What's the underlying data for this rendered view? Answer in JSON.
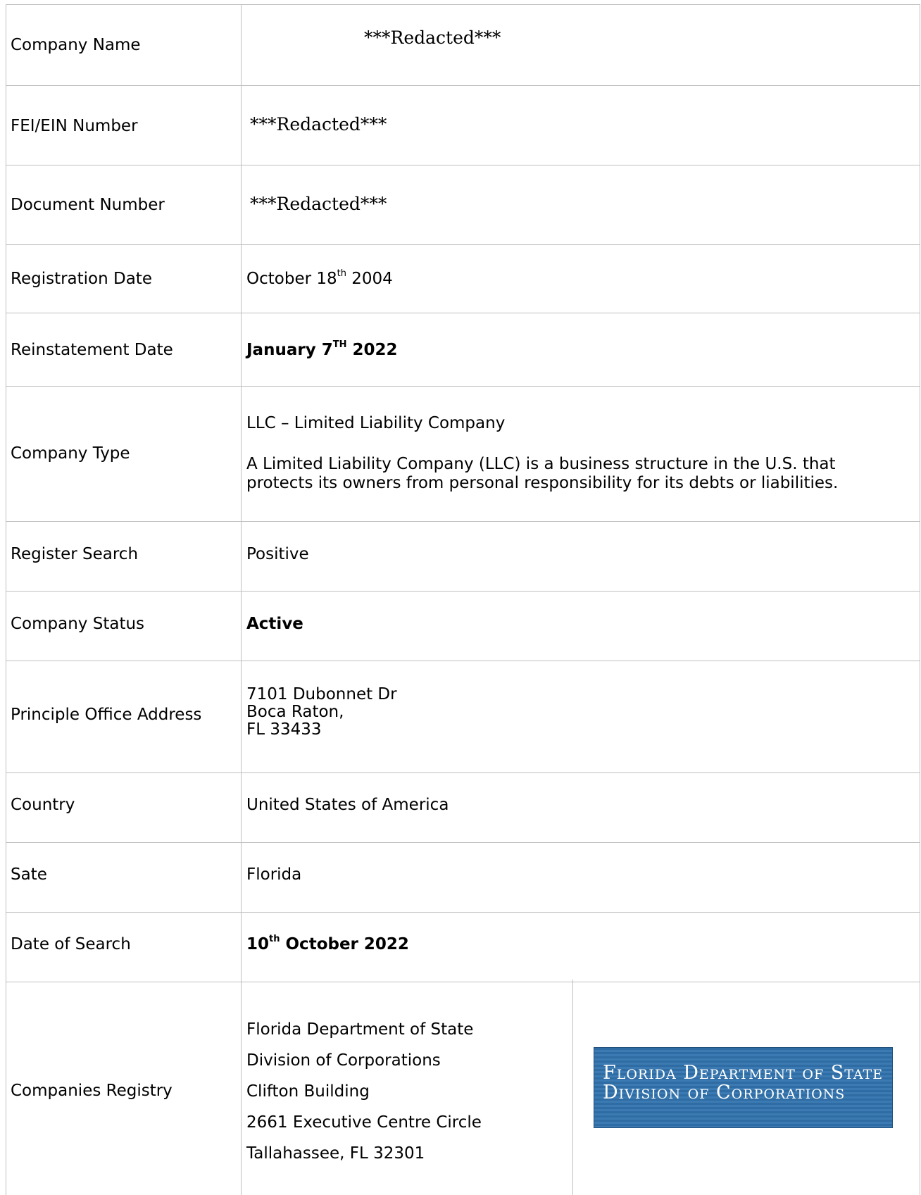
{
  "rows": [
    {
      "label": "Company Name",
      "value": "***Redacted***"
    },
    {
      "label": "FEI/EIN Number",
      "value": "***Redacted***"
    },
    {
      "label": "Document Number",
      "value": "***Redacted***"
    },
    {
      "label": "Registration Date",
      "value_main": "October 18",
      "value_sup": "th",
      "value_tail": " 2004"
    },
    {
      "label": "Reinstatement Date",
      "value_main": "January 7",
      "value_sup": "TH",
      "value_tail": " 2022"
    },
    {
      "label": "Company Type",
      "value_line1": "LLC – Limited Liability Company",
      "value_para": "A Limited Liability Company (LLC) is a business structure in the U.S. that protects its owners from personal responsibility for its debts or liabilities."
    },
    {
      "label": "Register Search",
      "value": "Positive"
    },
    {
      "label": "Company Status",
      "value": "Active"
    },
    {
      "label": "Principle Office Address",
      "lines": [
        "7101 Dubonnet Dr",
        "Boca Raton,",
        "FL 33433"
      ]
    },
    {
      "label": "Country",
      "value": "United States of America"
    },
    {
      "label": "Sate",
      "value": "Florida"
    },
    {
      "label": "Date of Search",
      "value_main": "10",
      "value_sup": "th",
      "value_tail": " October 2022"
    },
    {
      "label": "Companies Registry",
      "lines": [
        "Florida Department of State",
        "Division of Corporations",
        "Clifton Building",
        "2661 Executive Centre Circle",
        "Tallahassee, FL 32301"
      ]
    }
  ],
  "logo": {
    "line1": "Florida Department of State",
    "line2": "Division of Corporations",
    "colors": {
      "background": "#2f6ca3",
      "text": "#ffffff"
    }
  }
}
